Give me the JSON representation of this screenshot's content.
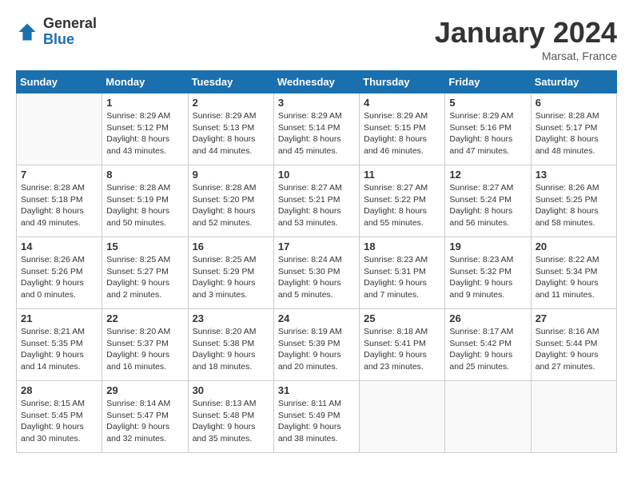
{
  "header": {
    "logo_general": "General",
    "logo_blue": "Blue",
    "month_title": "January 2024",
    "location": "Marsat, France"
  },
  "days_of_week": [
    "Sunday",
    "Monday",
    "Tuesday",
    "Wednesday",
    "Thursday",
    "Friday",
    "Saturday"
  ],
  "weeks": [
    [
      {
        "day": "",
        "sunrise": "",
        "sunset": "",
        "daylight": ""
      },
      {
        "day": "1",
        "sunrise": "Sunrise: 8:29 AM",
        "sunset": "Sunset: 5:12 PM",
        "daylight": "Daylight: 8 hours and 43 minutes."
      },
      {
        "day": "2",
        "sunrise": "Sunrise: 8:29 AM",
        "sunset": "Sunset: 5:13 PM",
        "daylight": "Daylight: 8 hours and 44 minutes."
      },
      {
        "day": "3",
        "sunrise": "Sunrise: 8:29 AM",
        "sunset": "Sunset: 5:14 PM",
        "daylight": "Daylight: 8 hours and 45 minutes."
      },
      {
        "day": "4",
        "sunrise": "Sunrise: 8:29 AM",
        "sunset": "Sunset: 5:15 PM",
        "daylight": "Daylight: 8 hours and 46 minutes."
      },
      {
        "day": "5",
        "sunrise": "Sunrise: 8:29 AM",
        "sunset": "Sunset: 5:16 PM",
        "daylight": "Daylight: 8 hours and 47 minutes."
      },
      {
        "day": "6",
        "sunrise": "Sunrise: 8:28 AM",
        "sunset": "Sunset: 5:17 PM",
        "daylight": "Daylight: 8 hours and 48 minutes."
      }
    ],
    [
      {
        "day": "7",
        "sunrise": "Sunrise: 8:28 AM",
        "sunset": "Sunset: 5:18 PM",
        "daylight": "Daylight: 8 hours and 49 minutes."
      },
      {
        "day": "8",
        "sunrise": "Sunrise: 8:28 AM",
        "sunset": "Sunset: 5:19 PM",
        "daylight": "Daylight: 8 hours and 50 minutes."
      },
      {
        "day": "9",
        "sunrise": "Sunrise: 8:28 AM",
        "sunset": "Sunset: 5:20 PM",
        "daylight": "Daylight: 8 hours and 52 minutes."
      },
      {
        "day": "10",
        "sunrise": "Sunrise: 8:27 AM",
        "sunset": "Sunset: 5:21 PM",
        "daylight": "Daylight: 8 hours and 53 minutes."
      },
      {
        "day": "11",
        "sunrise": "Sunrise: 8:27 AM",
        "sunset": "Sunset: 5:22 PM",
        "daylight": "Daylight: 8 hours and 55 minutes."
      },
      {
        "day": "12",
        "sunrise": "Sunrise: 8:27 AM",
        "sunset": "Sunset: 5:24 PM",
        "daylight": "Daylight: 8 hours and 56 minutes."
      },
      {
        "day": "13",
        "sunrise": "Sunrise: 8:26 AM",
        "sunset": "Sunset: 5:25 PM",
        "daylight": "Daylight: 8 hours and 58 minutes."
      }
    ],
    [
      {
        "day": "14",
        "sunrise": "Sunrise: 8:26 AM",
        "sunset": "Sunset: 5:26 PM",
        "daylight": "Daylight: 9 hours and 0 minutes."
      },
      {
        "day": "15",
        "sunrise": "Sunrise: 8:25 AM",
        "sunset": "Sunset: 5:27 PM",
        "daylight": "Daylight: 9 hours and 2 minutes."
      },
      {
        "day": "16",
        "sunrise": "Sunrise: 8:25 AM",
        "sunset": "Sunset: 5:29 PM",
        "daylight": "Daylight: 9 hours and 3 minutes."
      },
      {
        "day": "17",
        "sunrise": "Sunrise: 8:24 AM",
        "sunset": "Sunset: 5:30 PM",
        "daylight": "Daylight: 9 hours and 5 minutes."
      },
      {
        "day": "18",
        "sunrise": "Sunrise: 8:23 AM",
        "sunset": "Sunset: 5:31 PM",
        "daylight": "Daylight: 9 hours and 7 minutes."
      },
      {
        "day": "19",
        "sunrise": "Sunrise: 8:23 AM",
        "sunset": "Sunset: 5:32 PM",
        "daylight": "Daylight: 9 hours and 9 minutes."
      },
      {
        "day": "20",
        "sunrise": "Sunrise: 8:22 AM",
        "sunset": "Sunset: 5:34 PM",
        "daylight": "Daylight: 9 hours and 11 minutes."
      }
    ],
    [
      {
        "day": "21",
        "sunrise": "Sunrise: 8:21 AM",
        "sunset": "Sunset: 5:35 PM",
        "daylight": "Daylight: 9 hours and 14 minutes."
      },
      {
        "day": "22",
        "sunrise": "Sunrise: 8:20 AM",
        "sunset": "Sunset: 5:37 PM",
        "daylight": "Daylight: 9 hours and 16 minutes."
      },
      {
        "day": "23",
        "sunrise": "Sunrise: 8:20 AM",
        "sunset": "Sunset: 5:38 PM",
        "daylight": "Daylight: 9 hours and 18 minutes."
      },
      {
        "day": "24",
        "sunrise": "Sunrise: 8:19 AM",
        "sunset": "Sunset: 5:39 PM",
        "daylight": "Daylight: 9 hours and 20 minutes."
      },
      {
        "day": "25",
        "sunrise": "Sunrise: 8:18 AM",
        "sunset": "Sunset: 5:41 PM",
        "daylight": "Daylight: 9 hours and 23 minutes."
      },
      {
        "day": "26",
        "sunrise": "Sunrise: 8:17 AM",
        "sunset": "Sunset: 5:42 PM",
        "daylight": "Daylight: 9 hours and 25 minutes."
      },
      {
        "day": "27",
        "sunrise": "Sunrise: 8:16 AM",
        "sunset": "Sunset: 5:44 PM",
        "daylight": "Daylight: 9 hours and 27 minutes."
      }
    ],
    [
      {
        "day": "28",
        "sunrise": "Sunrise: 8:15 AM",
        "sunset": "Sunset: 5:45 PM",
        "daylight": "Daylight: 9 hours and 30 minutes."
      },
      {
        "day": "29",
        "sunrise": "Sunrise: 8:14 AM",
        "sunset": "Sunset: 5:47 PM",
        "daylight": "Daylight: 9 hours and 32 minutes."
      },
      {
        "day": "30",
        "sunrise": "Sunrise: 8:13 AM",
        "sunset": "Sunset: 5:48 PM",
        "daylight": "Daylight: 9 hours and 35 minutes."
      },
      {
        "day": "31",
        "sunrise": "Sunrise: 8:11 AM",
        "sunset": "Sunset: 5:49 PM",
        "daylight": "Daylight: 9 hours and 38 minutes."
      },
      {
        "day": "",
        "sunrise": "",
        "sunset": "",
        "daylight": ""
      },
      {
        "day": "",
        "sunrise": "",
        "sunset": "",
        "daylight": ""
      },
      {
        "day": "",
        "sunrise": "",
        "sunset": "",
        "daylight": ""
      }
    ]
  ]
}
